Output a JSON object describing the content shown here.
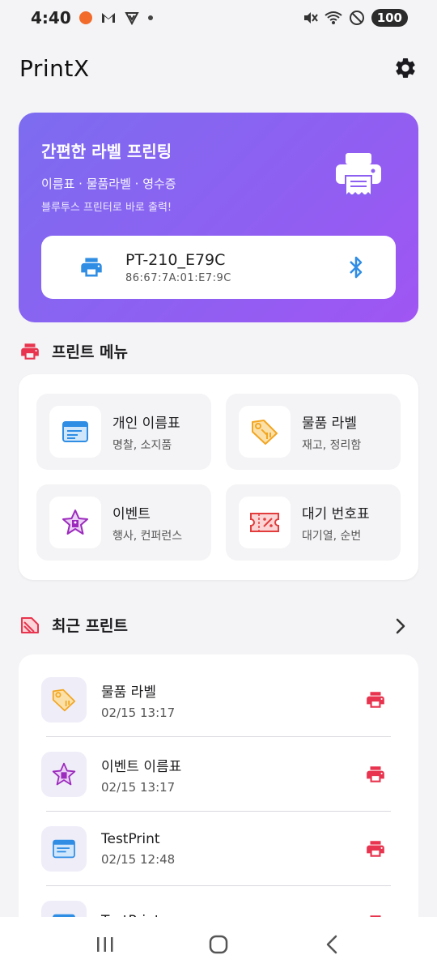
{
  "status_bar": {
    "time": "4:40",
    "battery": "100",
    "icons": [
      "orange-dot-icon",
      "gmail-icon",
      "shield-icon",
      "dot-icon",
      "mute-icon",
      "wifi-icon",
      "dnd-icon"
    ]
  },
  "app": {
    "title": "PrintX"
  },
  "hero": {
    "title": "간편한 라벨 프린팅",
    "subtitle": "이름표 · 물품라벨 · 영수증",
    "description": "블루투스 프린터로 바로 출력!",
    "device": {
      "name": "PT-210_E79C",
      "mac": "86:67:7A:01:E7:9C"
    }
  },
  "print_menu": {
    "header": "프린트 메뉴",
    "items": [
      {
        "title": "개인 이름표",
        "subtitle": "명찰, 소지품",
        "icon": "name-tag-icon"
      },
      {
        "title": "물품 라벨",
        "subtitle": "재고, 정리함",
        "icon": "price-tag-icon"
      },
      {
        "title": "이벤트",
        "subtitle": "행사, 컨퍼런스",
        "icon": "star-badge-icon"
      },
      {
        "title": "대기 번호표",
        "subtitle": "대기열, 순번",
        "icon": "ticket-icon"
      }
    ]
  },
  "recent": {
    "header": "최근 프린트",
    "items": [
      {
        "title": "물품 라벨",
        "date": "02/15 13:17",
        "icon": "price-tag-icon"
      },
      {
        "title": "이벤트 이름표",
        "date": "02/15 13:17",
        "icon": "star-badge-icon"
      },
      {
        "title": "TestPrint",
        "date": "02/15 12:48",
        "icon": "name-tag-icon"
      },
      {
        "title": "TestPrint",
        "date": "",
        "icon": "name-tag-icon"
      }
    ]
  },
  "colors": {
    "accent": "#8e60f2",
    "print_red": "#e8344e",
    "bluetooth_blue": "#2f8de4"
  }
}
